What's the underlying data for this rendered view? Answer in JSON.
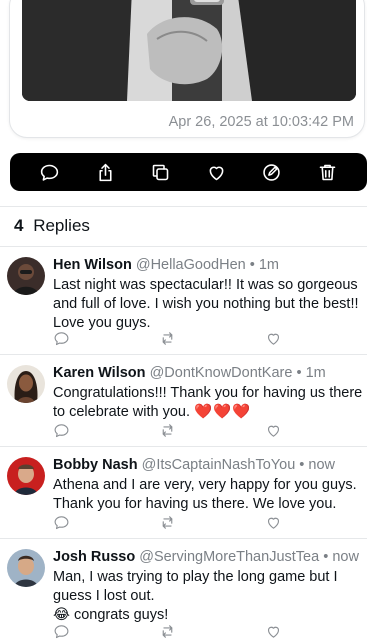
{
  "post": {
    "timestamp": "Apr 26, 2025 at 10:03:42 PM",
    "image_desc": "couple-holding-hands-photo"
  },
  "action_bar": {
    "icons": [
      "comment-icon",
      "share-icon",
      "copy-icon",
      "like-icon",
      "edit-icon",
      "delete-icon"
    ]
  },
  "replies": {
    "count": "4",
    "label": "Replies",
    "items": [
      {
        "name": "Hen Wilson",
        "handle": "@HellaGoodHen",
        "separator": "•",
        "time": "1m",
        "text": "Last night was spectacular!! It was so gorgeous and full of love. I wish you nothing but the best!! Love you guys."
      },
      {
        "name": "Karen Wilson",
        "handle": "@DontKnowDontKare",
        "separator": "•",
        "time": "1m",
        "text": "Congratulations!!! Thank you for having us there to celebrate with you.",
        "emoji": "❤️❤️❤️"
      },
      {
        "name": "Bobby Nash",
        "handle": "@ItsCaptainNashToYou",
        "separator": "•",
        "time": "now",
        "text": "Athena and I are very, very happy for you guys. Thank you for having us there. We love you."
      },
      {
        "name": "Josh Russo",
        "handle": "@ServingMoreThanJustTea",
        "separator": "•",
        "time": "now",
        "text": "Man, I was trying to play the long game but I guess I lost out.",
        "text2": "😂 congrats guys!"
      }
    ]
  }
}
